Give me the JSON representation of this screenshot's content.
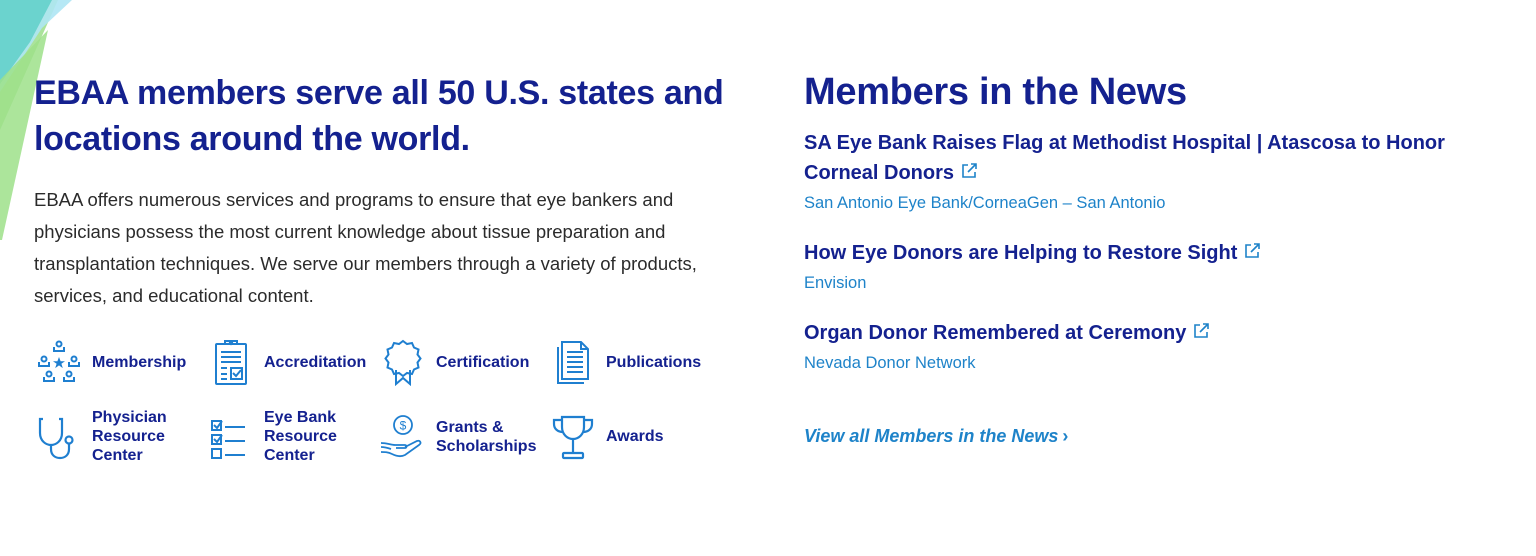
{
  "left": {
    "headline": "EBAA members serve all 50 U.S. states and locations around the world.",
    "intro": "EBAA offers numerous services and programs to ensure that eye bankers and physicians possess the most current knowledge about tissue preparation and transplantation techniques. We serve our members through a variety of products, services, and educational content.",
    "services": [
      {
        "label": "Membership",
        "icon": "membership-network-icon"
      },
      {
        "label": "Accreditation",
        "icon": "clipboard-check-icon"
      },
      {
        "label": "Certification",
        "icon": "ribbon-badge-icon"
      },
      {
        "label": "Publications",
        "icon": "documents-icon"
      },
      {
        "label": "Physician Resource Center",
        "icon": "stethoscope-icon"
      },
      {
        "label": "Eye Bank Resource Center",
        "icon": "checklist-icon"
      },
      {
        "label": "Grants & Scholarships",
        "icon": "hand-dollar-icon"
      },
      {
        "label": "Awards",
        "icon": "trophy-icon"
      }
    ]
  },
  "right": {
    "title": "Members in the News",
    "items": [
      {
        "headline": "SA Eye Bank Raises Flag at Methodist Hospital | Atascosa to Honor Corneal Donors",
        "source": "San Antonio Eye Bank/CorneaGen – San Antonio"
      },
      {
        "headline": "How Eye Donors are Helping to Restore Sight",
        "source": "Envision"
      },
      {
        "headline": "Organ Donor Remembered at Ceremony",
        "source": "Nevada Donor Network"
      }
    ],
    "view_all": "View all Members in the News",
    "view_all_chevron": "›"
  },
  "colors": {
    "navy": "#14218f",
    "link_blue": "#1e83c9",
    "icon_blue": "#1f7fd0",
    "teal": "#5fcfc9",
    "green": "#8fd97a"
  }
}
